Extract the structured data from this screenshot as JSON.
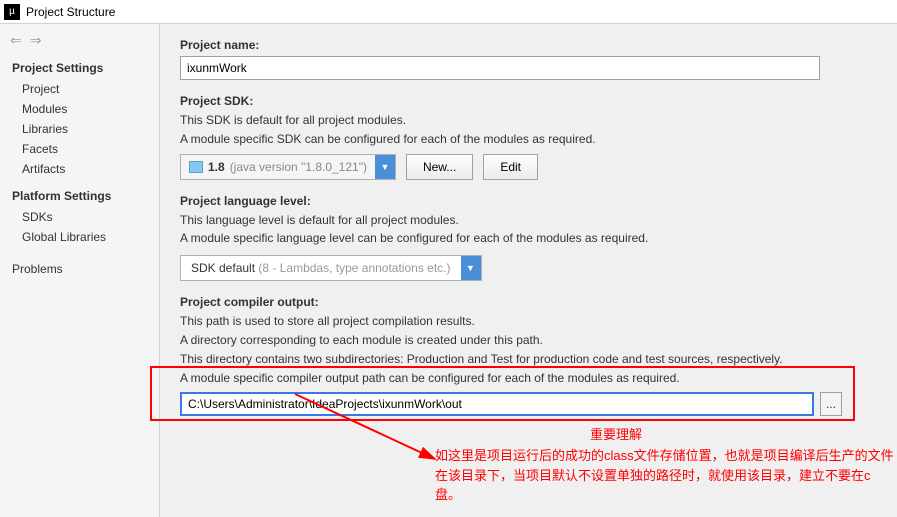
{
  "window": {
    "title": "Project Structure"
  },
  "sidebar": {
    "heading1": "Project Settings",
    "items1": [
      "Project",
      "Modules",
      "Libraries",
      "Facets",
      "Artifacts"
    ],
    "heading2": "Platform Settings",
    "items2": [
      "SDKs",
      "Global Libraries"
    ],
    "problems": "Problems"
  },
  "project_name": {
    "label": "Project name:",
    "value": "ixunmWork"
  },
  "sdk": {
    "label": "Project SDK:",
    "desc1": "This SDK is default for all project modules.",
    "desc2": "A module specific SDK can be configured for each of the modules as required.",
    "selected": "1.8",
    "selected_hint": "(java version \"1.8.0_121\")",
    "new_btn": "New...",
    "edit_btn": "Edit"
  },
  "lang": {
    "label": "Project language level:",
    "desc1": "This language level is default for all project modules.",
    "desc2": "A module specific language level can be configured for each of the modules as required.",
    "selected": "SDK default",
    "selected_hint": "(8 - Lambdas, type annotations etc.)"
  },
  "output": {
    "label": "Project compiler output:",
    "desc1": "This path is used to store all project compilation results.",
    "desc2": "A directory corresponding to each module is created under this path.",
    "desc3": "This directory contains two subdirectories: Production and Test for production code and test sources, respectively.",
    "desc4": "A module specific compiler output path can be configured for each of the modules as required.",
    "value": "C:\\Users\\Administrator\\IdeaProjects\\ixunmWork\\out",
    "browse": "..."
  },
  "annotation": {
    "title": "重要理解",
    "body": "如这里是项目运行后的成功的class文件存储位置，也就是项目编译后生产的文件在该目录下，当项目默认不设置单独的路径时，就使用该目录，建立不要在c盘。"
  }
}
